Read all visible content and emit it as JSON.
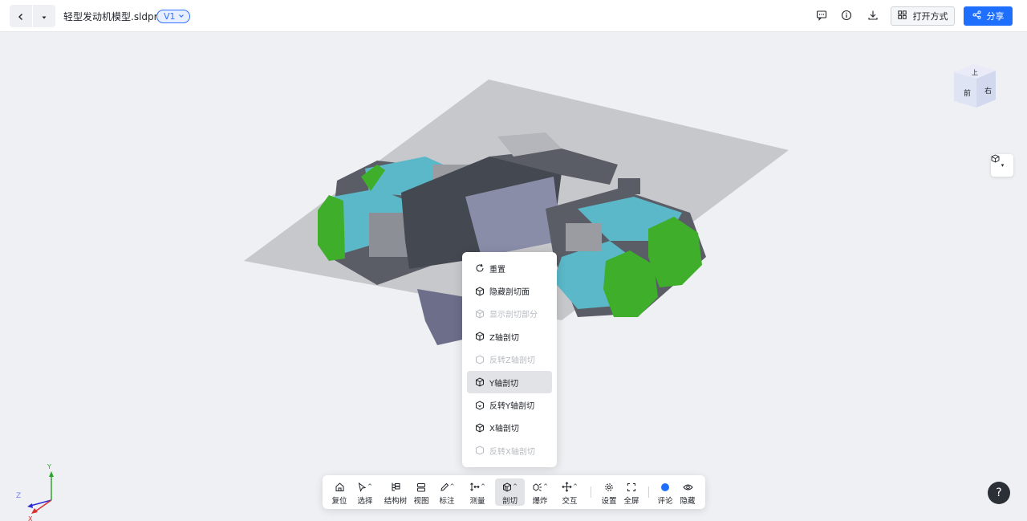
{
  "header": {
    "file_name": "轻型发动机模型.sldprt",
    "version": "V1",
    "open_with_label": "打开方式",
    "share_label": "分享",
    "icons": [
      "back-icon",
      "history-dropdown-icon",
      "comment-icon",
      "info-icon",
      "download-icon",
      "grid-icon",
      "share-icon"
    ]
  },
  "section_menu": {
    "items": [
      {
        "label": "重置",
        "icon": "reset-icon",
        "state": "enabled"
      },
      {
        "label": "隐藏剖切面",
        "icon": "cube-icon",
        "state": "enabled"
      },
      {
        "label": "显示剖切部分",
        "icon": "cube-icon",
        "state": "disabled"
      },
      {
        "label": "Z轴剖切",
        "icon": "cube-icon",
        "state": "enabled"
      },
      {
        "label": "反转Z轴剖切",
        "icon": "cube-icon",
        "state": "disabled"
      },
      {
        "label": "Y轴剖切",
        "icon": "cube-icon",
        "state": "selected"
      },
      {
        "label": "反转Y轴剖切",
        "icon": "cube-icon",
        "state": "enabled"
      },
      {
        "label": "X轴剖切",
        "icon": "cube-icon",
        "state": "enabled"
      },
      {
        "label": "反转X轴剖切",
        "icon": "cube-icon",
        "state": "disabled"
      }
    ]
  },
  "toolbar": {
    "items": [
      {
        "label": "复位",
        "icon": "home-icon"
      },
      {
        "label": "选择",
        "icon": "cursor-icon"
      },
      {
        "label": "结构树",
        "icon": "tree-icon"
      },
      {
        "label": "视图",
        "icon": "view-icon"
      },
      {
        "label": "标注",
        "icon": "pen-icon"
      },
      {
        "label": "测量",
        "icon": "measure-icon"
      },
      {
        "label": "剖切",
        "icon": "section-icon"
      },
      {
        "label": "爆炸",
        "icon": "explode-icon"
      },
      {
        "label": "交互",
        "icon": "move-icon"
      },
      {
        "label": "设置",
        "icon": "gear-icon"
      },
      {
        "label": "全屏",
        "icon": "fullscreen-icon"
      },
      {
        "label": "评论",
        "icon": "comment-dot-icon"
      },
      {
        "label": "隐藏",
        "icon": "eye-icon"
      }
    ]
  },
  "view_cube": {
    "front_label": "前",
    "right_label": "右",
    "top_label": "上"
  },
  "axes": {
    "y_label": "Y",
    "z_label": "Z",
    "x_label": "X"
  },
  "help_label": "?",
  "colors": {
    "accent": "#1f6fff",
    "engine_green": "#3fae2a",
    "engine_cyan": "#5ab8c8",
    "engine_body": "#5a5d66",
    "plane": "#c7c8cb"
  }
}
